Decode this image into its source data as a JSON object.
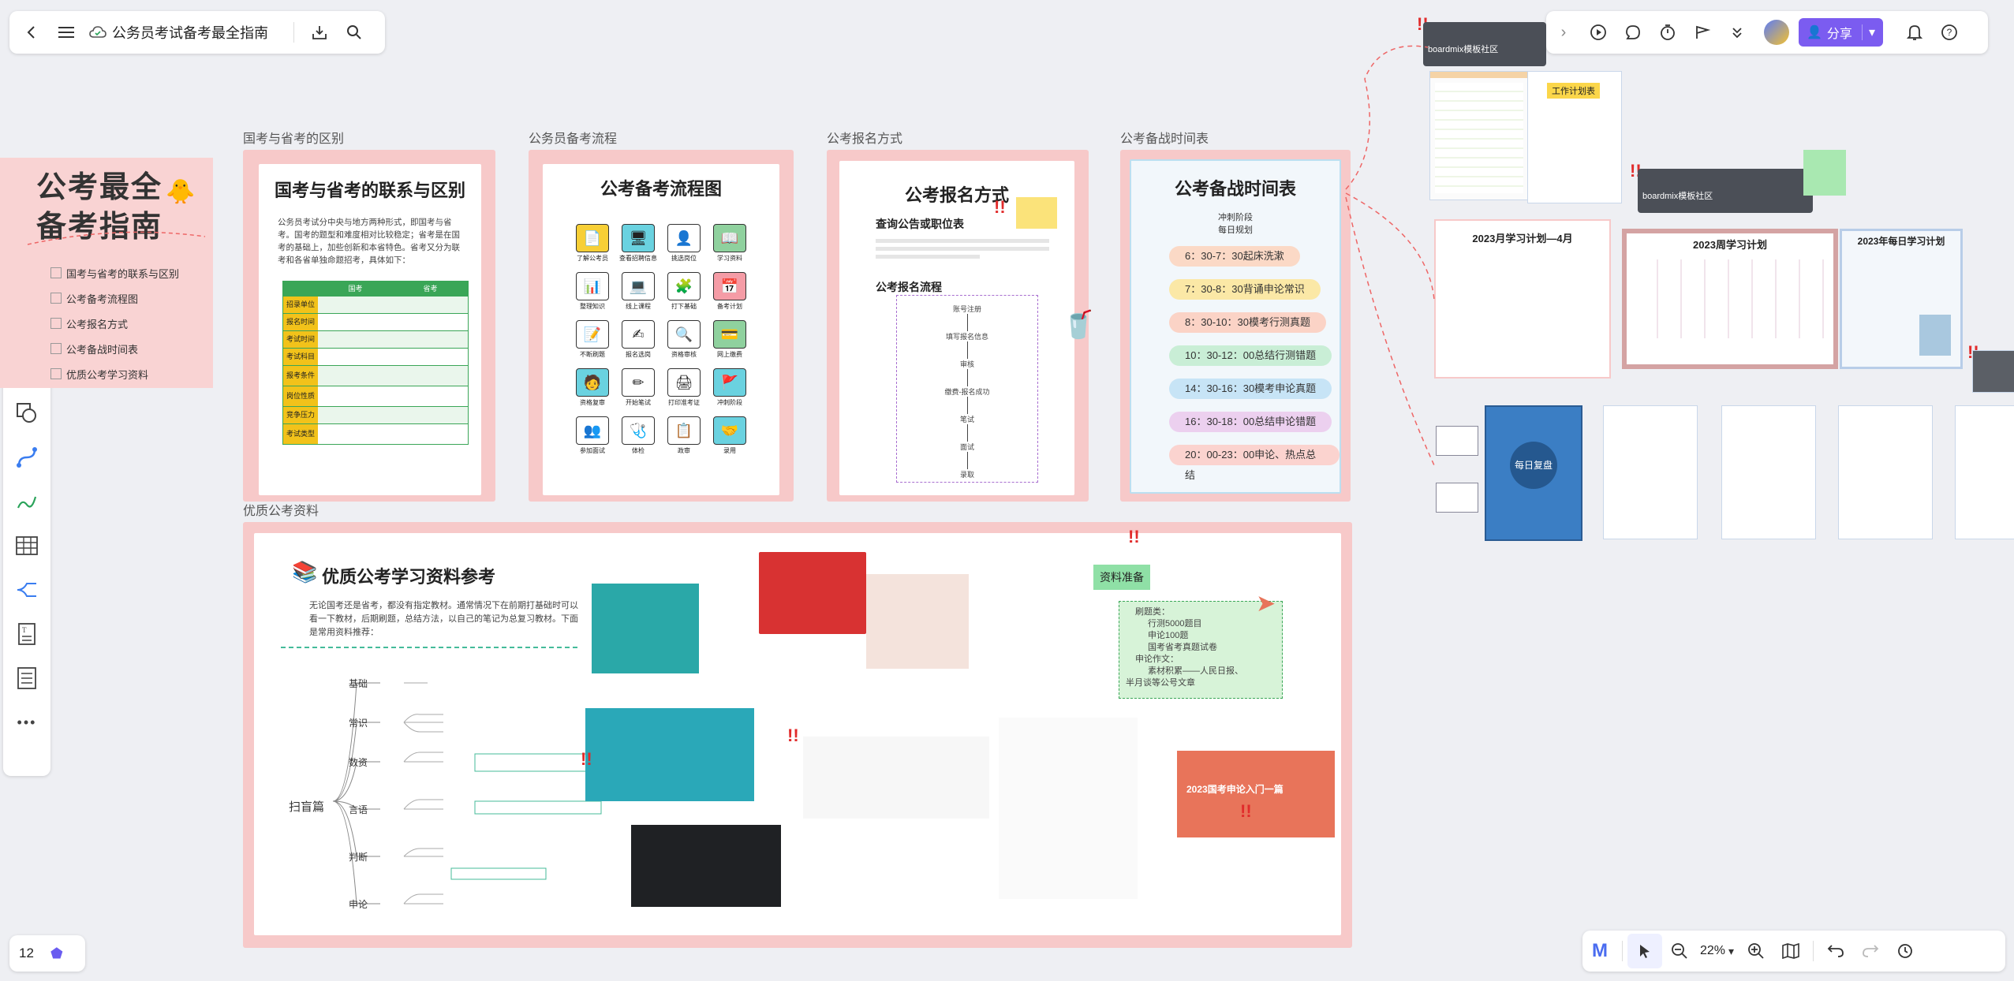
{
  "topbar": {
    "doc_title": "公务员考试备考最全指南"
  },
  "right_toolbar": {
    "share_label": "分享"
  },
  "bottom_left": {
    "page_count": "12"
  },
  "zoom": {
    "level": "22%"
  },
  "frame_labels": {
    "diff": "国考与省考的区别",
    "flow": "公务员备考流程",
    "reg": "公考报名方式",
    "schedule": "公考备战时间表",
    "materials": "优质公考资料"
  },
  "cover": {
    "title_line1": "公考最全",
    "title_line2": "备考指南",
    "toc": [
      "国考与省考的联系与区别",
      "公考备考流程图",
      "公考报名方式",
      "公考备战时间表",
      "优质公考学习资料"
    ]
  },
  "diff_card": {
    "title": "国考与省考的联系与区别",
    "intro": "公务员考试分中央与地方两种形式，即国考与省考。国考的题型和难度相对比较稳定；省考是在国考的基础上，加些创新和本省特色。省考又分为联考和各省单独命题招考，具体如下：",
    "table_head": [
      "国考",
      "省考"
    ],
    "rows": [
      "招录单位",
      "报名时间",
      "考试时间",
      "考试科目",
      "报考条件",
      "岗位性质",
      "竞争压力",
      "考试类型"
    ]
  },
  "flow_card": {
    "title": "公考备考流程图",
    "steps": [
      "了解公考员",
      "查看招聘信息",
      "挑选岗位",
      "学习资料",
      "整理知识",
      "线上课程",
      "打下基础",
      "备考计划",
      "不断刷题",
      "报名选岗",
      "资格审核",
      "网上缴费",
      "资格复审",
      "开始笔试",
      "打印准考证",
      "冲刺阶段",
      "参加面试",
      "体检",
      "政审",
      "录用"
    ]
  },
  "reg_card": {
    "title": "公考报名方式",
    "sub1": "查询公告或职位表",
    "sub2": "公考报名流程",
    "steps": [
      "账号注册",
      "填写报名信息",
      "审核",
      "缴费-报名成功",
      "笔试",
      "面试",
      "录取"
    ]
  },
  "schedule_card": {
    "title": "公考备战时间表",
    "phase": "冲刺阶段",
    "daily": "每日规划",
    "items": [
      "6：30-7：30起床洗漱",
      "7：30-8：30背诵申论常识",
      "8：30-10：30模考行测真题",
      "10：30-12：00总结行测错题",
      "14：30-16：30模考申论真题",
      "16：30-18：00总结申论错题",
      "20：00-23：00申论、热点总结"
    ]
  },
  "materials": {
    "title": "优质公考学习资料参考",
    "intro": "无论国考还是省考，都没有指定教材。通常情况下在前期打基础时可以看一下教材，后期刷题，总结方法，以自己的笔记为总复习教材。下面是常用资料推荐：",
    "prep_tag": "资料准备",
    "note_lines": [
      "刷题类：",
      "行测5000题目",
      "申论100题",
      "国考省考真题试卷",
      "申论作文：",
      "素材积累——人民日报、",
      "半月谈等公号文章"
    ],
    "mindmap_root": "扫盲篇",
    "mindmap_branches": [
      "基础",
      "常识",
      "数资",
      "言语",
      "判断",
      "申论"
    ],
    "video_caption": "2023国考申论入门一篇"
  },
  "right_area": {
    "work_plan": "工作计划表",
    "month_plan": "2023月学习计划—4月",
    "week_plan": "2023周学习计划",
    "day_plan": "2023年每日学习计划",
    "daily_check": "每日复盘",
    "comment_tag": "boardmix模板社区"
  },
  "colors": {
    "frame_pink": "#f7c9c9",
    "share_purple": "#7b5cf0",
    "table_yellow": "#f2c21a",
    "table_green": "#3aa657"
  }
}
